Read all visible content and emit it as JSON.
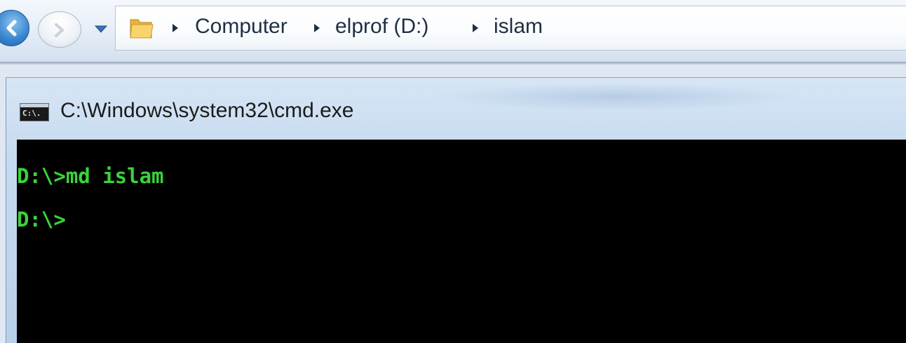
{
  "explorer": {
    "breadcrumbs": [
      "Computer",
      "elprof (D:)",
      "islam"
    ],
    "icons": {
      "back": "back-arrow-icon",
      "forward": "forward-arrow-icon",
      "history": "chevron-down-icon",
      "folder": "folder-icon",
      "separator": "chevron-right-icon"
    }
  },
  "cmd": {
    "window_title": "C:\\Windows\\system32\\cmd.exe",
    "icon_text": "C:\\.",
    "text_color": "#39d43a",
    "background_color": "#000000",
    "lines": [
      "D:\\>md islam",
      "D:\\>"
    ]
  }
}
